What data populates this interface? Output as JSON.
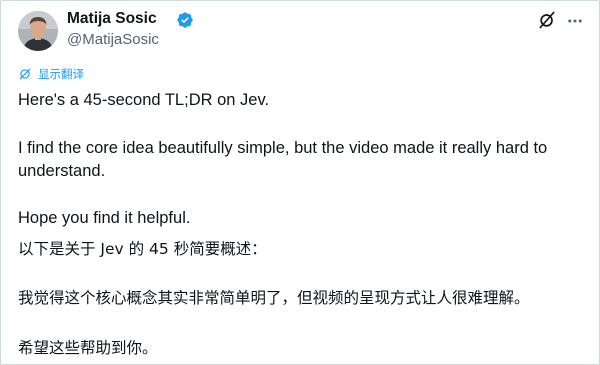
{
  "author": {
    "name": "Matija Sosic",
    "handle": "@MatijaSosic"
  },
  "icons": {
    "verified": "verified-badge-icon",
    "grok": "grok-icon",
    "more": "more-options-icon",
    "translate": "translate-icon"
  },
  "colors": {
    "accent": "#1d9bf0",
    "text": "#0f1419",
    "secondary": "#536471"
  },
  "translate": {
    "label": "显示翻译"
  },
  "post": {
    "line1": "Here's a 45-second TL;DR on Jev.",
    "line2a": "I find the core idea beautifully simple, but the video made it really hard to",
    "line2b": "understand.",
    "line3": "Hope you find it helpful.",
    "cn1": "以下是关于 Jev 的 45 秒简要概述：",
    "cn2": "我觉得这个核心概念其实非常简单明了，但视频的呈现方式让人很难理解。",
    "cn3": "希望这些帮助到你。"
  }
}
